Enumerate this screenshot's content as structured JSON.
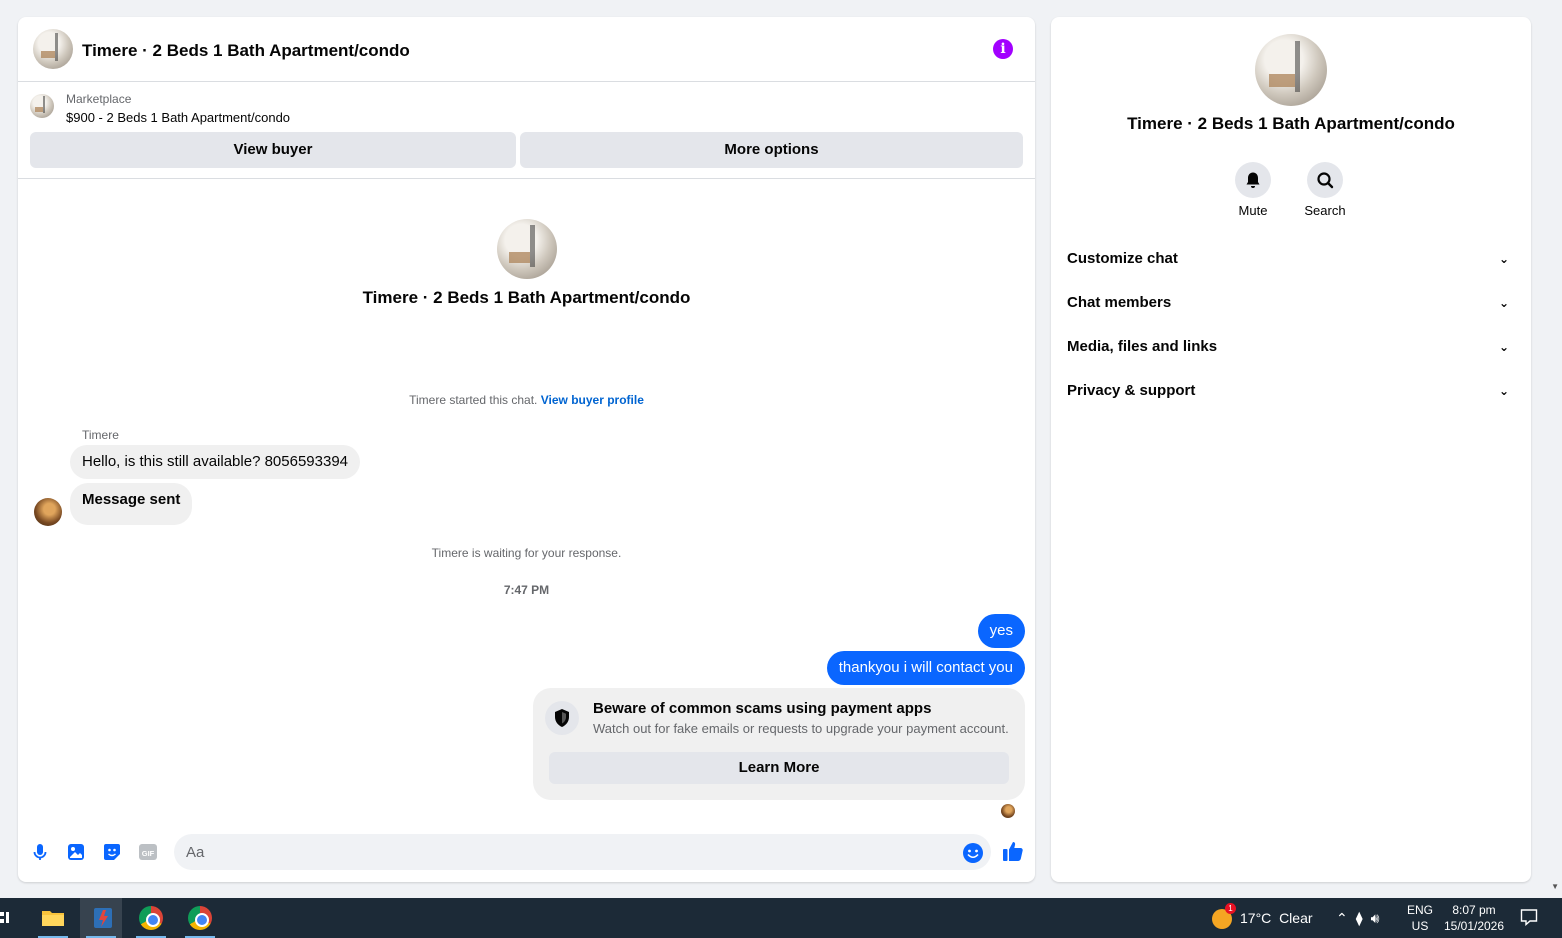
{
  "header": {
    "title": "Timere · 2 Beds 1 Bath Apartment/condo",
    "info_icon": "i"
  },
  "listing": {
    "source": "Marketplace",
    "price_title": "$900 - 2 Beds 1 Bath Apartment/condo",
    "view_buyer_label": "View buyer",
    "more_options_label": "More options"
  },
  "intro": {
    "title": "Timere · 2 Beds 1 Bath Apartment/condo"
  },
  "thread": {
    "started_text": "Timere started this chat.",
    "started_link": "View buyer profile",
    "sender_name": "Timere",
    "incoming": [
      "Hello, is this still available? 8056593394",
      "Message sent"
    ],
    "waiting_text": "Timere is waiting for your response.",
    "timestamp": "7:47 PM",
    "outgoing": [
      "yes",
      "thankyou i will contact you"
    ]
  },
  "scam_notice": {
    "title": "Beware of common scams using payment apps",
    "body": "Watch out for fake emails or requests to upgrade your payment account.",
    "button": "Learn More"
  },
  "composer": {
    "placeholder": "Aa"
  },
  "side_panel": {
    "title": "Timere · 2 Beds 1 Bath Apartment/condo",
    "actions": [
      "Mute",
      "Search"
    ],
    "sections": [
      "Customize chat",
      "Chat members",
      "Media, files and links",
      "Privacy & support"
    ]
  },
  "taskbar": {
    "weather_temp": "17°C",
    "weather_desc": "Clear",
    "weather_badge": "1",
    "lang_line1": "ENG",
    "lang_line2": "US",
    "time": "8:07 pm",
    "date": "15/01/2026"
  },
  "colors": {
    "accent_blue": "#0a66ff",
    "info_purple": "#a200ff",
    "taskbar_bg": "#1c2a37"
  }
}
